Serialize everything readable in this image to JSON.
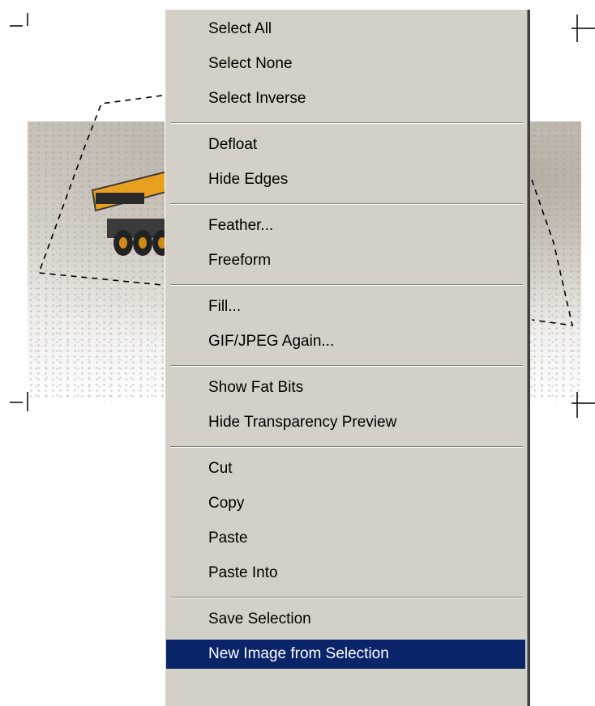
{
  "colors": {
    "menu_bg": "#d4d0c8",
    "highlight_bg": "#0a246a",
    "highlight_text": "#ffffff",
    "text": "#000000",
    "separator_dark": "#808080"
  },
  "context_menu": {
    "groups": [
      {
        "items": [
          {
            "label": "Select All"
          },
          {
            "label": "Select None"
          },
          {
            "label": "Select Inverse"
          }
        ]
      },
      {
        "items": [
          {
            "label": "Defloat"
          },
          {
            "label": "Hide Edges"
          }
        ]
      },
      {
        "items": [
          {
            "label": "Feather..."
          },
          {
            "label": "Freeform"
          }
        ]
      },
      {
        "items": [
          {
            "label": "Fill..."
          },
          {
            "label": "GIF/JPEG Again..."
          }
        ]
      },
      {
        "items": [
          {
            "label": "Show Fat Bits"
          },
          {
            "label": "Hide Transparency Preview"
          }
        ]
      },
      {
        "items": [
          {
            "label": "Cut"
          },
          {
            "label": "Copy"
          },
          {
            "label": "Paste"
          },
          {
            "label": "Paste Into"
          }
        ]
      },
      {
        "items": [
          {
            "label": "Save Selection"
          },
          {
            "label": "New Image from Selection",
            "highlighted": true
          }
        ]
      }
    ]
  }
}
